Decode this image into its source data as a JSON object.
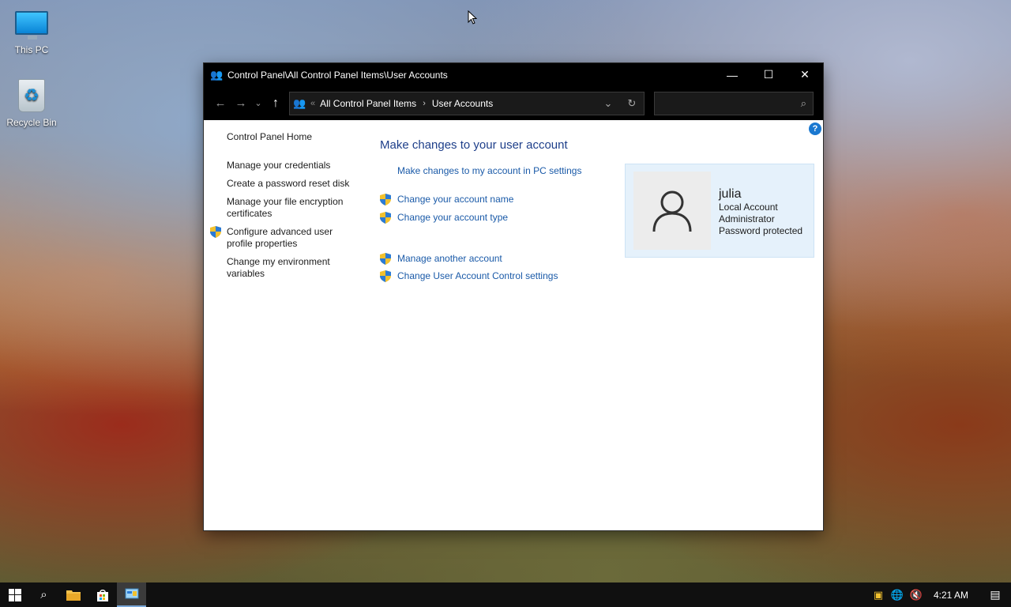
{
  "desktop": {
    "icons": [
      {
        "label": "This PC"
      },
      {
        "label": "Recycle Bin"
      }
    ]
  },
  "window": {
    "title": "Control Panel\\All Control Panel Items\\User Accounts",
    "address": {
      "overflow": "«",
      "crumbs": [
        "All Control Panel Items",
        "User Accounts"
      ]
    },
    "search_placeholder": ""
  },
  "left_nav": {
    "home": "Control Panel Home",
    "items": [
      {
        "label": "Manage your credentials"
      },
      {
        "label": "Create a password reset disk"
      },
      {
        "label": "Manage your file encryption certificates"
      },
      {
        "label": "Configure advanced user profile properties"
      },
      {
        "label": "Change my environment variables"
      }
    ]
  },
  "main": {
    "heading": "Make changes to your user account",
    "links": [
      {
        "label": "Make changes to my account in PC settings"
      },
      {
        "label": "Change your account name"
      },
      {
        "label": "Change your account type"
      },
      {
        "label": "Manage another account"
      },
      {
        "label": "Change User Account Control settings"
      }
    ]
  },
  "account": {
    "username": "julia",
    "type": "Local Account",
    "role": "Administrator",
    "status": "Password protected"
  },
  "taskbar": {
    "clock": "4:21 AM"
  },
  "colors": {
    "link": "#1a5aa8",
    "heading": "#1e3f8a",
    "card_bg": "#e5f1fb",
    "titlebar": "#000000"
  },
  "icons": [
    "monitor-icon",
    "recycle-bin-icon",
    "user-accounts-icon",
    "minimize-icon",
    "maximize-icon",
    "close-icon",
    "back-arrow-icon",
    "forward-arrow-icon",
    "up-arrow-icon",
    "refresh-icon",
    "search-icon",
    "help-icon",
    "uac-shield-icon",
    "user-avatar-icon",
    "windows-start-icon",
    "file-explorer-icon",
    "store-icon",
    "network-icon",
    "volume-muted-icon",
    "notification-icon"
  ]
}
